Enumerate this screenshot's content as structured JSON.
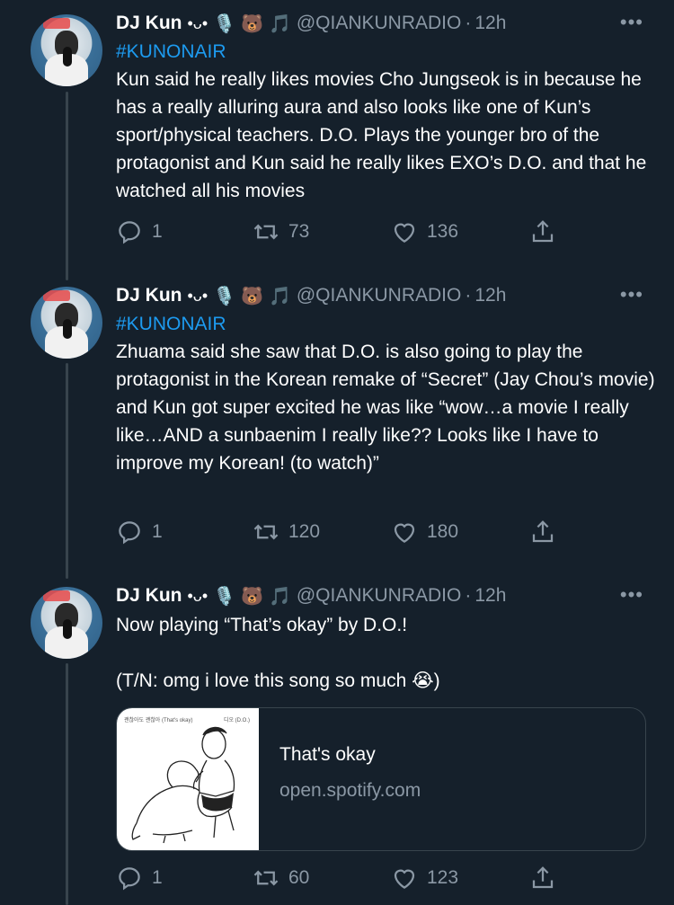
{
  "tweets": [
    {
      "name": "DJ Kun",
      "deco": "•ᴗ•",
      "emoji": [
        "🎙️",
        "🐻",
        "🎵"
      ],
      "handle": "@QIANKUNRADIO",
      "sep": "·",
      "time": "12h",
      "more": "•••",
      "hashtag": "#KUNONAIR",
      "body": "Kun said he really likes movies Cho Jungseok is in because he has a really alluring aura and also looks like one of Kun’s sport/physical teachers. D.O. Plays the younger bro of the protagonist and Kun said he really likes EXO’s D.O. and that he watched all his movies",
      "replies": "1",
      "retweets": "73",
      "likes": "136"
    },
    {
      "name": "DJ Kun",
      "deco": "•ᴗ•",
      "emoji": [
        "🎙️",
        "🐻",
        "🎵"
      ],
      "handle": "@QIANKUNRADIO",
      "sep": "·",
      "time": "12h",
      "more": "•••",
      "hashtag": "#KUNONAIR",
      "body": "Zhuama said she saw that D.O. is also going to play the protagonist in the Korean remake of “Secret” (Jay Chou’s movie) and Kun got super excited he was like “wow…a movie I really like…AND a sunbaenim I really like?? Looks like I have to improve my Korean! (to watch)”",
      "replies": "1",
      "retweets": "120",
      "likes": "180"
    },
    {
      "name": "DJ Kun",
      "deco": "•ᴗ•",
      "emoji": [
        "🎙️",
        "🐻",
        "🎵"
      ],
      "handle": "@QIANKUNRADIO",
      "sep": "·",
      "time": "12h",
      "more": "•••",
      "line1": "Now playing “That’s okay” by D.O.!",
      "line2": "(T/N: omg i love this song so much 😭)",
      "card": {
        "title": "That's okay",
        "domain": "open.spotify.com",
        "album_label_left": "괜찮아도 괜찮아 (That's okay)",
        "album_label_right": "디오 (D.O.)"
      },
      "replies": "1",
      "retweets": "60",
      "likes": "123"
    }
  ]
}
